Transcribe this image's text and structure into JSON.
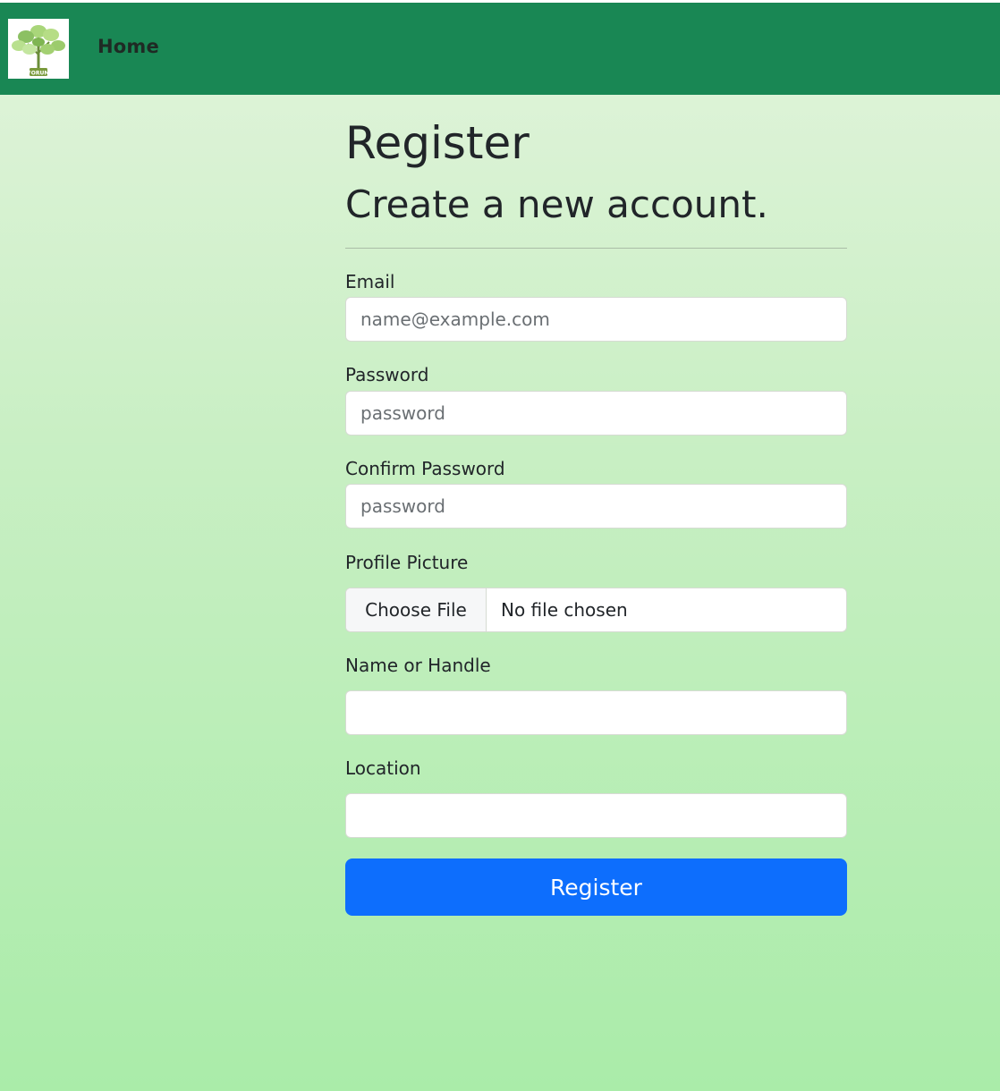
{
  "navbar": {
    "logo_text": "FORUM",
    "home_label": "Home",
    "background": "#198754"
  },
  "page": {
    "title": "Register",
    "subtitle": "Create a new account."
  },
  "form": {
    "email": {
      "label": "Email",
      "placeholder": "name@example.com",
      "value": ""
    },
    "password": {
      "label": "Password",
      "placeholder": "password",
      "value": ""
    },
    "confirm_password": {
      "label": "Confirm Password",
      "placeholder": "password",
      "value": ""
    },
    "profile_picture": {
      "label": "Profile Picture",
      "button_label": "Choose File",
      "status": "No file chosen"
    },
    "name": {
      "label": "Name or Handle",
      "placeholder": "",
      "value": ""
    },
    "location": {
      "label": "Location",
      "placeholder": "",
      "value": ""
    },
    "submit_label": "Register"
  },
  "colors": {
    "primary_button": "#0d6efd",
    "navbar": "#198754"
  },
  "icons": {
    "logo": "tree-forum-logo"
  }
}
